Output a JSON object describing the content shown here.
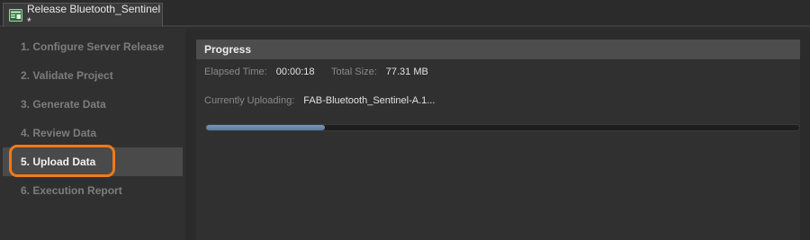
{
  "tab": {
    "title": "Release Bluetooth_Sentinel *",
    "icon": "release-document-icon"
  },
  "sidebar": {
    "items": [
      {
        "label": "1. Configure Server Release",
        "active": false
      },
      {
        "label": "2. Validate Project",
        "active": false
      },
      {
        "label": "3. Generate Data",
        "active": false
      },
      {
        "label": "4. Review Data",
        "active": false
      },
      {
        "label": "5. Upload Data",
        "active": true
      },
      {
        "label": "6. Execution Report",
        "active": false
      }
    ]
  },
  "progress": {
    "header": "Progress",
    "elapsed_label": "Elapsed Time:",
    "elapsed_value": "00:00:18",
    "size_label": "Total Size:",
    "size_value": "77.31 MB",
    "uploading_label": "Currently Uploading:",
    "uploading_value": "FAB-Bluetooth_Sentinel-A.1...",
    "fill_fraction": 0.2
  },
  "colors": {
    "highlight": "#f07a1a",
    "progress_fill": "#6a88aa"
  }
}
